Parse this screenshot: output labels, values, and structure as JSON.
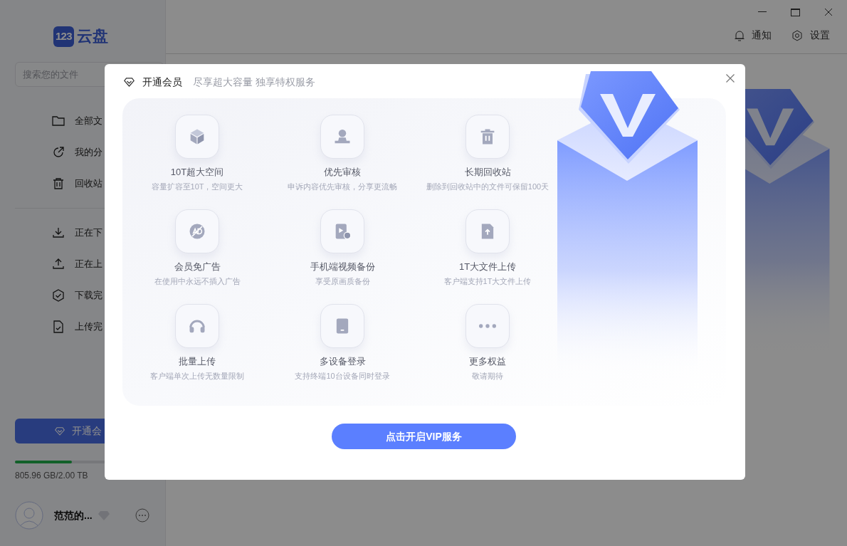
{
  "header": {
    "notify": "通知",
    "settings": "设置"
  },
  "sidebar": {
    "logo": {
      "badge": "123",
      "text": "云盘"
    },
    "search": {
      "placeholder": "搜索您的文件"
    },
    "nav_groups": [
      [
        {
          "label": "全部文"
        },
        {
          "label": "我的分"
        },
        {
          "label": "回收站"
        }
      ],
      [
        {
          "label": "正在下"
        },
        {
          "label": "正在上"
        },
        {
          "label": "下载完"
        },
        {
          "label": "上传完"
        }
      ]
    ],
    "vip_button": "开通会",
    "storage": {
      "level": 0.4,
      "reading": "805.96 GB/2.00 TB"
    },
    "user": {
      "name": "范范的..."
    }
  },
  "modal": {
    "title": "开通会员",
    "subtitle": "尽享超大容量 独享特权服务",
    "features": [
      {
        "title": "10T超大空间",
        "desc": "容量扩容至10T，空间更大"
      },
      {
        "title": "优先审核",
        "desc": "申诉内容优先审核，分享更流畅"
      },
      {
        "title": "长期回收站",
        "desc": "删除到回收站中的文件可保留100天"
      },
      {
        "title": "会员免广告",
        "desc": "在使用中永远不插入广告"
      },
      {
        "title": "手机端视频备份",
        "desc": "享受原画质备份"
      },
      {
        "title": "1T大文件上传",
        "desc": "客户端支持1T大文件上传"
      },
      {
        "title": "批量上传",
        "desc": "客户端单次上传无数量限制"
      },
      {
        "title": "多设备登录",
        "desc": "支持终端10台设备同时登录"
      },
      {
        "title": "更多权益",
        "desc": "敬请期待"
      }
    ],
    "cta": "点击开启VIP服务"
  }
}
